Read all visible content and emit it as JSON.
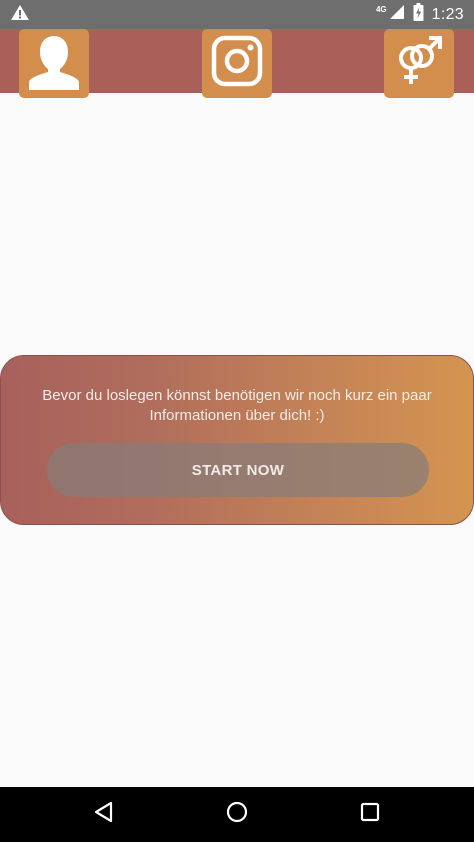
{
  "status_bar": {
    "time": "1:23",
    "network_label": "4G",
    "icons": [
      "warning-icon",
      "signal-icon",
      "battery-icon"
    ]
  },
  "top_bar": {
    "background": "#a86058",
    "tile_color": "#d38d4c",
    "tiles": [
      "profile-icon",
      "instagram-icon",
      "gender-icon"
    ]
  },
  "card": {
    "message": "Bevor du loslegen könnst benötigen wir noch kurz ein paar Informationen über dich! :)",
    "start_button_label": "START NOW"
  },
  "nav_bar": {
    "icons": [
      "back-icon",
      "home-icon",
      "recents-icon"
    ]
  }
}
